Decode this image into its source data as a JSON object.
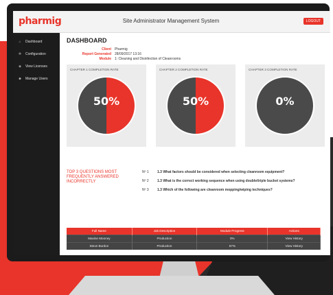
{
  "header": {
    "logo": "pharmig",
    "app_title": "Site Administrator Management System",
    "logout_label": "LOGOUT"
  },
  "sidebar": {
    "items": [
      {
        "icon": "dashboard-icon",
        "glyph": "⌂",
        "label": "Dashboard"
      },
      {
        "icon": "configuration-icon",
        "glyph": "✲",
        "label": "Configuration"
      },
      {
        "icon": "licenses-icon",
        "glyph": "◈",
        "label": "View Licenses"
      },
      {
        "icon": "users-icon",
        "glyph": "☻",
        "label": "Manage Users"
      }
    ]
  },
  "dashboard": {
    "title": "DASHBOARD",
    "info": [
      {
        "key": "Client",
        "value": "Pharmig"
      },
      {
        "key": "Report Generated",
        "value": "28/09/2017 13:16"
      },
      {
        "key": "Module",
        "value": "1: Cleaning and Disinfection of Cleanrooms"
      }
    ],
    "charts": [
      {
        "title": "CHAPTER 1 COMPLETION RATE",
        "percent_label": "50%"
      },
      {
        "title": "CHAPTER 2 COMPLETION RATE",
        "percent_label": "50%"
      },
      {
        "title": "CHAPTER 3 COMPLETION RATE",
        "percent_label": "0%"
      }
    ],
    "top3_heading": "TOP 3 QUESTIONS MOST FREQUENTLY ANSWERED INCORRECTLY",
    "questions": [
      {
        "num": "Nº 1",
        "text": "1.3 What factors should be considered when selecting cleanroom equipment?"
      },
      {
        "num": "Nº 2",
        "text": "1.3 What is the correct working sequence when using double/triple bucket systems?"
      },
      {
        "num": "Nº 3",
        "text": "1.3 Which of the following are cleanroom mopping/wiping techniques?"
      }
    ],
    "table": {
      "headers": [
        "Full Name",
        "Job Description",
        "Module Progress",
        "Actions"
      ],
      "rows": [
        [
          "Maxine Mooney",
          "Production",
          "0%",
          "View History"
        ],
        [
          "Steve Burdon",
          "Production",
          "57%",
          "View History"
        ]
      ]
    }
  },
  "colors": {
    "accent": "#e8342a",
    "chart_fill": "#e8342a",
    "chart_remaining": "#4a4a4a",
    "sidebar_bg": "#1c1c1c"
  },
  "chart_data": [
    {
      "type": "pie",
      "title": "CHAPTER 1 COMPLETION RATE",
      "values": [
        50,
        50
      ],
      "labels": [
        "",
        ""
      ]
    },
    {
      "type": "pie",
      "title": "CHAPTER 2 COMPLETION RATE",
      "values": [
        50,
        50
      ],
      "labels": [
        "",
        ""
      ]
    },
    {
      "type": "pie",
      "title": "CHAPTER 3 COMPLETION RATE",
      "values": [
        0,
        100
      ],
      "labels": [
        "",
        ""
      ]
    }
  ]
}
